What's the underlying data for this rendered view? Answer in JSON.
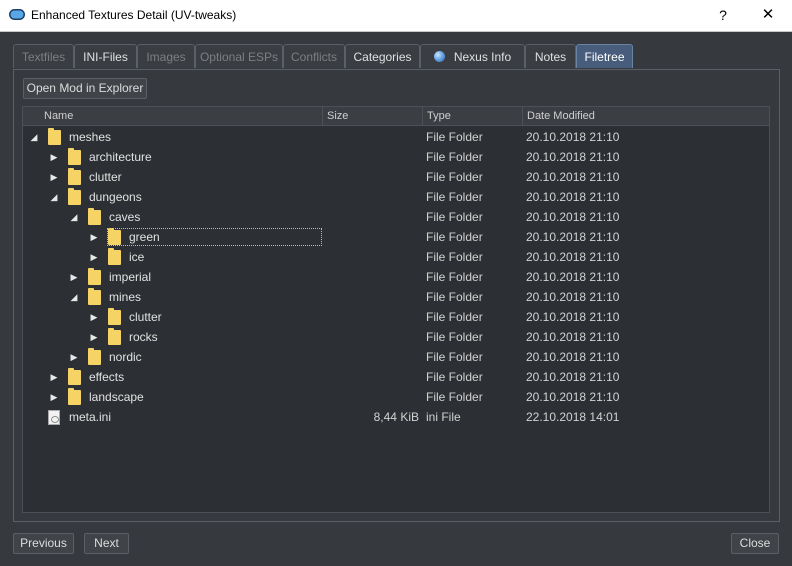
{
  "window": {
    "title": "Enhanced Textures Detail (UV-tweaks)",
    "help": "?",
    "close": "✕"
  },
  "tabs": [
    {
      "label": "Textfiles",
      "state": "disabled"
    },
    {
      "label": "INI-Files",
      "state": "enabled"
    },
    {
      "label": "Images",
      "state": "disabled"
    },
    {
      "label": "Optional ESPs",
      "state": "disabled"
    },
    {
      "label": "Conflicts",
      "state": "disabled"
    },
    {
      "label": "Categories",
      "state": "enabled"
    },
    {
      "label": "Nexus Info",
      "state": "enabled",
      "icon": "globe-icon"
    },
    {
      "label": "Notes",
      "state": "enabled"
    },
    {
      "label": "Filetree",
      "state": "active"
    }
  ],
  "toolbar": {
    "open_explorer": "Open Mod in Explorer"
  },
  "table": {
    "headers": {
      "name": "Name",
      "size": "Size",
      "type": "Type",
      "date": "Date Modified"
    },
    "rows": [
      {
        "name": "meshes",
        "depth": 0,
        "expander": "expanded",
        "icon": "folder-icon",
        "size": "",
        "type": "File Folder",
        "date": "20.10.2018 21:10"
      },
      {
        "name": "architecture",
        "depth": 1,
        "expander": "collapsed",
        "icon": "folder-icon",
        "size": "",
        "type": "File Folder",
        "date": "20.10.2018 21:10"
      },
      {
        "name": "clutter",
        "depth": 1,
        "expander": "collapsed",
        "icon": "folder-icon",
        "size": "",
        "type": "File Folder",
        "date": "20.10.2018 21:10"
      },
      {
        "name": "dungeons",
        "depth": 1,
        "expander": "expanded",
        "icon": "folder-icon",
        "size": "",
        "type": "File Folder",
        "date": "20.10.2018 21:10"
      },
      {
        "name": "caves",
        "depth": 2,
        "expander": "expanded",
        "icon": "folder-icon",
        "size": "",
        "type": "File Folder",
        "date": "20.10.2018 21:10"
      },
      {
        "name": "green",
        "depth": 3,
        "expander": "collapsed",
        "icon": "folder-icon",
        "size": "",
        "type": "File Folder",
        "date": "20.10.2018 21:10",
        "selected": true
      },
      {
        "name": "ice",
        "depth": 3,
        "expander": "collapsed",
        "icon": "folder-icon",
        "size": "",
        "type": "File Folder",
        "date": "20.10.2018 21:10"
      },
      {
        "name": "imperial",
        "depth": 2,
        "expander": "collapsed",
        "icon": "folder-icon",
        "size": "",
        "type": "File Folder",
        "date": "20.10.2018 21:10"
      },
      {
        "name": "mines",
        "depth": 2,
        "expander": "expanded",
        "icon": "folder-icon",
        "size": "",
        "type": "File Folder",
        "date": "20.10.2018 21:10"
      },
      {
        "name": "clutter",
        "depth": 3,
        "expander": "collapsed",
        "icon": "folder-icon",
        "size": "",
        "type": "File Folder",
        "date": "20.10.2018 21:10"
      },
      {
        "name": "rocks",
        "depth": 3,
        "expander": "collapsed",
        "icon": "folder-icon",
        "size": "",
        "type": "File Folder",
        "date": "20.10.2018 21:10"
      },
      {
        "name": "nordic",
        "depth": 2,
        "expander": "collapsed",
        "icon": "folder-icon",
        "size": "",
        "type": "File Folder",
        "date": "20.10.2018 21:10"
      },
      {
        "name": "effects",
        "depth": 1,
        "expander": "collapsed",
        "icon": "folder-icon",
        "size": "",
        "type": "File Folder",
        "date": "20.10.2018 21:10"
      },
      {
        "name": "landscape",
        "depth": 1,
        "expander": "collapsed",
        "icon": "folder-icon",
        "size": "",
        "type": "File Folder",
        "date": "20.10.2018 21:10"
      },
      {
        "name": "meta.ini",
        "depth": 0,
        "expander": "none",
        "icon": "ini-file-icon",
        "size": "8,44 KiB",
        "type": "ini File",
        "date": "22.10.2018 14:01"
      }
    ]
  },
  "footer": {
    "previous": "Previous",
    "next": "Next",
    "close": "Close"
  },
  "colors": {
    "background": "#36393e",
    "tree_background": "#2c2f33",
    "active_tab": "#485d7c",
    "folder": "#f6d365"
  }
}
